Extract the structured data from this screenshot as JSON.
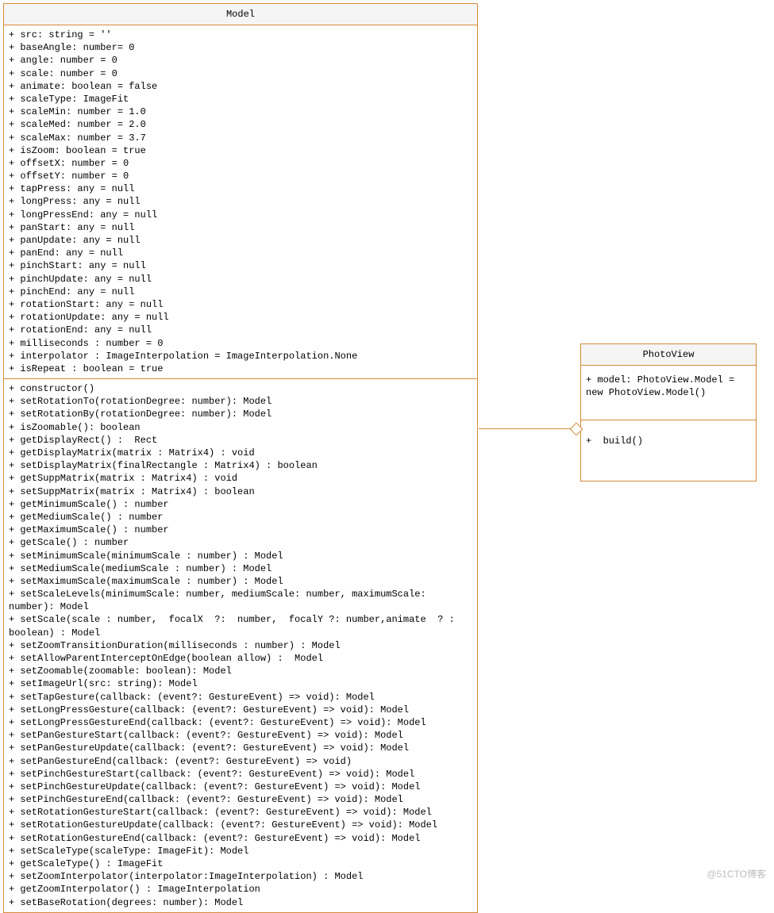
{
  "model": {
    "title": "Model",
    "attributes": [
      "+ src: string = ''",
      "+ baseAngle: number= 0",
      "+ angle: number = 0",
      "+ scale: number = 0",
      "+ animate: boolean = false",
      "+ scaleType: ImageFit",
      "+ scaleMin: number = 1.0",
      "+ scaleMed: number = 2.0",
      "+ scaleMax: number = 3.7",
      "+ isZoom: boolean = true",
      "+ offsetX: number = 0",
      "+ offsetY: number = 0",
      "+ tapPress: any = null",
      "+ longPress: any = null",
      "+ longPressEnd: any = null",
      "+ panStart: any = null",
      "+ panUpdate: any = null",
      "+ panEnd: any = null",
      "+ pinchStart: any = null",
      "+ pinchUpdate: any = null",
      "+ pinchEnd: any = null",
      "+ rotationStart: any = null",
      "+ rotationUpdate: any = null",
      "+ rotationEnd: any = null",
      "+ milliseconds : number = 0",
      "+ interpolator : ImageInterpolation = ImageInterpolation.None",
      "+ isRepeat : boolean = true"
    ],
    "methods": [
      "+ constructor()",
      "+ setRotationTo(rotationDegree: number): Model",
      "+ setRotationBy(rotationDegree: number): Model",
      "+ isZoomable(): boolean",
      "+ getDisplayRect() :  Rect",
      "+ getDisplayMatrix(matrix : Matrix4) : void",
      "+ setDisplayMatrix(finalRectangle : Matrix4) : boolean",
      "+ getSuppMatrix(matrix : Matrix4) : void",
      "+ setSuppMatrix(matrix : Matrix4) : boolean",
      "+ getMinimumScale() : number",
      "+ getMediumScale() : number",
      "+ getMaximumScale() : number",
      "+ getScale() : number",
      "+ setMinimumScale(minimumScale : number) : Model",
      "+ setMediumScale(mediumScale : number) : Model",
      "+ setMaximumScale(maximumScale : number) : Model",
      "+ setScaleLevels(minimumScale: number, mediumScale: number, maximumScale: number): Model",
      "+ setScale(scale : number,  focalX  ?:  number,  focalY ?: number,animate  ? : boolean) : Model",
      "+ setZoomTransitionDuration(milliseconds : number) : Model",
      "+ setAllowParentInterceptOnEdge(boolean allow) :  Model",
      "+ setZoomable(zoomable: boolean): Model",
      "+ setImageUrl(src: string): Model",
      "+ setTapGesture(callback: (event?: GestureEvent) => void): Model",
      "+ setLongPressGesture(callback: (event?: GestureEvent) => void): Model",
      "+ setLongPressGestureEnd(callback: (event?: GestureEvent) => void): Model",
      "+ setPanGestureStart(callback: (event?: GestureEvent) => void): Model",
      "+ setPanGestureUpdate(callback: (event?: GestureEvent) => void): Model",
      "+ setPanGestureEnd(callback: (event?: GestureEvent) => void)",
      "+ setPinchGestureStart(callback: (event?: GestureEvent) => void): Model",
      "+ setPinchGestureUpdate(callback: (event?: GestureEvent) => void): Model",
      "+ setPinchGestureEnd(callback: (event?: GestureEvent) => void): Model",
      "+ setRotationGestureStart(callback: (event?: GestureEvent) => void): Model",
      "+ setRotationGestureUpdate(callback: (event?: GestureEvent) => void): Model",
      "+ setRotationGestureEnd(callback: (event?: GestureEvent) => void): Model",
      "+ setScaleType(scaleType: ImageFit): Model",
      "+ getScaleType() : ImageFit",
      "+ setZoomInterpolator(interpolator:ImageInterpolation) : Model",
      "+ getZoomInterpolator() : ImageInterpolation",
      "+ setBaseRotation(degrees: number): Model"
    ]
  },
  "photoview": {
    "title": "PhotoView",
    "attributes": [
      "+ model: PhotoView.Model = new PhotoView.Model()"
    ],
    "methods": [
      "+  build()"
    ]
  },
  "watermark": "@51CTO博客"
}
